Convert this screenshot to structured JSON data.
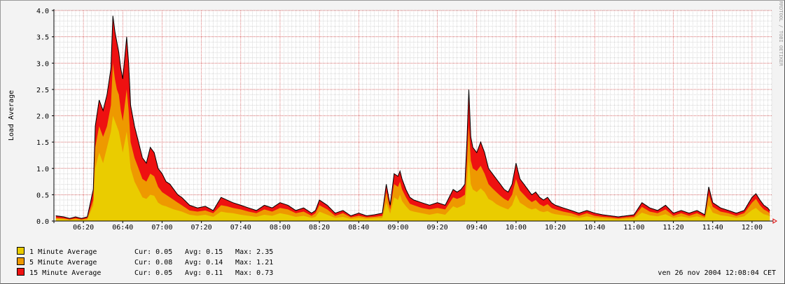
{
  "chart_data": {
    "type": "area",
    "ylabel": "Load Average",
    "ylim": [
      0,
      4.0
    ],
    "y_ticks": [
      "0.0",
      "0.5",
      "1.0",
      "1.5",
      "2.0",
      "2.5",
      "3.0",
      "3.5",
      "4.0"
    ],
    "x_ticks": [
      "06:20",
      "06:40",
      "07:00",
      "07:20",
      "07:40",
      "08:00",
      "08:20",
      "08:40",
      "09:00",
      "09:20",
      "09:40",
      "10:00",
      "10:20",
      "10:40",
      "11:00",
      "11:20",
      "11:40",
      "12:00"
    ],
    "x_start": "06:05",
    "x_end": "12:10",
    "grid": true,
    "watermark": "RRDTOOL / TOBI OETIKER",
    "series": [
      {
        "name": "15 Minute Average",
        "color": "#ee1111",
        "x": [
          "06:06",
          "06:10",
          "06:13",
          "06:16",
          "06:19",
          "06:22",
          "06:25",
          "06:26",
          "06:28",
          "06:30",
          "06:32",
          "06:34",
          "06:35",
          "06:36",
          "06:37",
          "06:38",
          "06:39",
          "06:40",
          "06:41",
          "06:42",
          "06:43",
          "06:44",
          "06:46",
          "06:48",
          "06:50",
          "06:52",
          "06:54",
          "06:56",
          "06:58",
          "07:00",
          "07:02",
          "07:04",
          "07:06",
          "07:08",
          "07:10",
          "07:14",
          "07:18",
          "07:22",
          "07:26",
          "07:30",
          "07:33",
          "07:36",
          "07:40",
          "07:44",
          "07:48",
          "07:52",
          "07:56",
          "08:00",
          "08:04",
          "08:08",
          "08:12",
          "08:16",
          "08:18",
          "08:20",
          "08:24",
          "08:28",
          "08:32",
          "08:36",
          "08:40",
          "08:44",
          "08:48",
          "08:52",
          "08:54",
          "08:56",
          "08:58",
          "09:00",
          "09:01",
          "09:02",
          "09:04",
          "09:06",
          "09:08",
          "09:12",
          "09:16",
          "09:20",
          "09:24",
          "09:28",
          "09:30",
          "09:32",
          "09:34",
          "09:35",
          "09:36",
          "09:37",
          "09:38",
          "09:40",
          "09:42",
          "09:44",
          "09:46",
          "09:48",
          "09:50",
          "09:52",
          "09:54",
          "09:56",
          "09:58",
          "10:00",
          "10:02",
          "10:04",
          "10:06",
          "10:08",
          "10:10",
          "10:12",
          "10:14",
          "10:16",
          "10:18",
          "10:20",
          "10:24",
          "10:28",
          "10:32",
          "10:36",
          "10:40",
          "10:44",
          "10:48",
          "10:52",
          "10:56",
          "11:00",
          "11:04",
          "11:08",
          "11:12",
          "11:16",
          "11:20",
          "11:24",
          "11:28",
          "11:32",
          "11:36",
          "11:38",
          "11:40",
          "11:44",
          "11:48",
          "11:52",
          "11:56",
          "12:00",
          "12:02",
          "12:04",
          "12:06",
          "12:08",
          "12:09"
        ],
        "values": [
          0.1,
          0.08,
          0.05,
          0.08,
          0.05,
          0.08,
          0.6,
          1.8,
          2.3,
          2.1,
          2.4,
          2.9,
          3.9,
          3.6,
          3.4,
          3.2,
          2.9,
          2.7,
          3.1,
          3.5,
          3.0,
          2.2,
          1.8,
          1.5,
          1.2,
          1.1,
          1.4,
          1.3,
          1.0,
          0.9,
          0.75,
          0.7,
          0.6,
          0.5,
          0.45,
          0.3,
          0.25,
          0.28,
          0.2,
          0.45,
          0.4,
          0.35,
          0.3,
          0.25,
          0.2,
          0.3,
          0.25,
          0.35,
          0.3,
          0.2,
          0.25,
          0.15,
          0.2,
          0.4,
          0.3,
          0.15,
          0.2,
          0.1,
          0.15,
          0.1,
          0.12,
          0.15,
          0.7,
          0.3,
          0.9,
          0.85,
          0.95,
          0.8,
          0.6,
          0.45,
          0.4,
          0.35,
          0.3,
          0.35,
          0.3,
          0.6,
          0.55,
          0.6,
          0.7,
          1.5,
          2.5,
          1.6,
          1.4,
          1.3,
          1.5,
          1.3,
          1.0,
          0.9,
          0.8,
          0.7,
          0.6,
          0.55,
          0.7,
          1.1,
          0.8,
          0.7,
          0.6,
          0.5,
          0.55,
          0.45,
          0.4,
          0.45,
          0.35,
          0.3,
          0.25,
          0.2,
          0.15,
          0.2,
          0.15,
          0.12,
          0.1,
          0.08,
          0.1,
          0.12,
          0.35,
          0.25,
          0.2,
          0.3,
          0.15,
          0.2,
          0.15,
          0.2,
          0.12,
          0.65,
          0.35,
          0.25,
          0.2,
          0.15,
          0.2,
          0.45,
          0.52,
          0.4,
          0.3,
          0.25,
          0.2
        ]
      },
      {
        "name": "5 Minute Average",
        "color": "#ee9900",
        "x": [
          "06:06",
          "06:10",
          "06:13",
          "06:16",
          "06:19",
          "06:22",
          "06:25",
          "06:26",
          "06:28",
          "06:30",
          "06:32",
          "06:34",
          "06:35",
          "06:36",
          "06:37",
          "06:38",
          "06:39",
          "06:40",
          "06:41",
          "06:42",
          "06:43",
          "06:44",
          "06:46",
          "06:48",
          "06:50",
          "06:52",
          "06:54",
          "06:56",
          "06:58",
          "07:00",
          "07:02",
          "07:04",
          "07:06",
          "07:08",
          "07:10",
          "07:14",
          "07:18",
          "07:22",
          "07:26",
          "07:30",
          "07:33",
          "07:36",
          "07:40",
          "07:44",
          "07:48",
          "07:52",
          "07:56",
          "08:00",
          "08:04",
          "08:08",
          "08:12",
          "08:16",
          "08:18",
          "08:20",
          "08:24",
          "08:28",
          "08:32",
          "08:36",
          "08:40",
          "08:44",
          "08:48",
          "08:52",
          "08:54",
          "08:56",
          "08:58",
          "09:00",
          "09:01",
          "09:02",
          "09:04",
          "09:06",
          "09:08",
          "09:12",
          "09:16",
          "09:20",
          "09:24",
          "09:28",
          "09:30",
          "09:32",
          "09:34",
          "09:35",
          "09:36",
          "09:37",
          "09:38",
          "09:40",
          "09:42",
          "09:44",
          "09:46",
          "09:48",
          "09:50",
          "09:52",
          "09:54",
          "09:56",
          "09:58",
          "10:00",
          "10:02",
          "10:04",
          "10:06",
          "10:08",
          "10:10",
          "10:12",
          "10:14",
          "10:16",
          "10:18",
          "10:20",
          "10:24",
          "10:28",
          "10:32",
          "10:36",
          "10:40",
          "10:44",
          "10:48",
          "10:52",
          "10:56",
          "11:00",
          "11:04",
          "11:08",
          "11:12",
          "11:16",
          "11:20",
          "11:24",
          "11:28",
          "11:32",
          "11:36",
          "11:38",
          "11:40",
          "11:44",
          "11:48",
          "11:52",
          "11:56",
          "12:00",
          "12:02",
          "12:04",
          "12:06",
          "12:08",
          "12:09"
        ],
        "values": [
          0.06,
          0.05,
          0.03,
          0.05,
          0.03,
          0.05,
          0.4,
          1.4,
          1.8,
          1.6,
          1.8,
          2.2,
          3.0,
          2.7,
          2.5,
          2.4,
          2.1,
          1.9,
          2.2,
          2.5,
          2.1,
          1.5,
          1.2,
          1.0,
          0.8,
          0.75,
          0.9,
          0.85,
          0.65,
          0.55,
          0.5,
          0.45,
          0.4,
          0.35,
          0.3,
          0.2,
          0.18,
          0.2,
          0.15,
          0.3,
          0.28,
          0.25,
          0.22,
          0.18,
          0.15,
          0.22,
          0.18,
          0.25,
          0.22,
          0.15,
          0.18,
          0.1,
          0.15,
          0.3,
          0.22,
          0.1,
          0.15,
          0.07,
          0.1,
          0.07,
          0.08,
          0.1,
          0.55,
          0.22,
          0.7,
          0.65,
          0.75,
          0.6,
          0.45,
          0.33,
          0.3,
          0.25,
          0.22,
          0.25,
          0.22,
          0.45,
          0.42,
          0.45,
          0.5,
          1.1,
          1.8,
          1.15,
          1.0,
          0.95,
          1.05,
          0.9,
          0.7,
          0.62,
          0.55,
          0.48,
          0.42,
          0.38,
          0.5,
          0.8,
          0.58,
          0.5,
          0.42,
          0.36,
          0.4,
          0.32,
          0.28,
          0.32,
          0.25,
          0.22,
          0.18,
          0.15,
          0.1,
          0.15,
          0.1,
          0.08,
          0.07,
          0.05,
          0.07,
          0.08,
          0.27,
          0.18,
          0.15,
          0.22,
          0.1,
          0.15,
          0.1,
          0.15,
          0.08,
          0.5,
          0.27,
          0.18,
          0.15,
          0.1,
          0.15,
          0.35,
          0.42,
          0.3,
          0.22,
          0.18,
          0.15
        ]
      },
      {
        "name": "1 Minute Average",
        "color": "#eacc00",
        "x": [
          "06:06",
          "06:10",
          "06:13",
          "06:16",
          "06:19",
          "06:22",
          "06:25",
          "06:26",
          "06:28",
          "06:30",
          "06:32",
          "06:34",
          "06:35",
          "06:36",
          "06:37",
          "06:38",
          "06:39",
          "06:40",
          "06:41",
          "06:42",
          "06:43",
          "06:44",
          "06:46",
          "06:48",
          "06:50",
          "06:52",
          "06:54",
          "06:56",
          "06:58",
          "07:00",
          "07:02",
          "07:04",
          "07:06",
          "07:08",
          "07:10",
          "07:14",
          "07:18",
          "07:22",
          "07:26",
          "07:30",
          "07:33",
          "07:36",
          "07:40",
          "07:44",
          "07:48",
          "07:52",
          "07:56",
          "08:00",
          "08:04",
          "08:08",
          "08:12",
          "08:16",
          "08:18",
          "08:20",
          "08:24",
          "08:28",
          "08:32",
          "08:36",
          "08:40",
          "08:44",
          "08:48",
          "08:52",
          "08:54",
          "08:56",
          "08:58",
          "09:00",
          "09:01",
          "09:02",
          "09:04",
          "09:06",
          "09:08",
          "09:12",
          "09:16",
          "09:20",
          "09:24",
          "09:28",
          "09:30",
          "09:32",
          "09:34",
          "09:35",
          "09:36",
          "09:37",
          "09:38",
          "09:40",
          "09:42",
          "09:44",
          "09:46",
          "09:48",
          "09:50",
          "09:52",
          "09:54",
          "09:56",
          "09:58",
          "10:00",
          "10:02",
          "10:04",
          "10:06",
          "10:08",
          "10:10",
          "10:12",
          "10:14",
          "10:16",
          "10:18",
          "10:20",
          "10:24",
          "10:28",
          "10:32",
          "10:36",
          "10:40",
          "10:44",
          "10:48",
          "10:52",
          "10:56",
          "11:00",
          "11:04",
          "11:08",
          "11:12",
          "11:16",
          "11:20",
          "11:24",
          "11:28",
          "11:32",
          "11:36",
          "11:38",
          "11:40",
          "11:44",
          "11:48",
          "11:52",
          "11:56",
          "12:00",
          "12:02",
          "12:04",
          "12:06",
          "12:08",
          "12:09"
        ],
        "values": [
          0.04,
          0.03,
          0.02,
          0.03,
          0.02,
          0.03,
          0.3,
          1.0,
          1.3,
          1.1,
          1.4,
          1.7,
          2.0,
          1.9,
          1.8,
          1.7,
          1.5,
          1.3,
          1.5,
          1.7,
          1.4,
          1.0,
          0.75,
          0.6,
          0.45,
          0.42,
          0.5,
          0.48,
          0.35,
          0.3,
          0.28,
          0.25,
          0.22,
          0.2,
          0.18,
          0.12,
          0.1,
          0.12,
          0.08,
          0.18,
          0.16,
          0.15,
          0.12,
          0.1,
          0.08,
          0.12,
          0.1,
          0.15,
          0.12,
          0.08,
          0.1,
          0.06,
          0.08,
          0.18,
          0.12,
          0.06,
          0.08,
          0.04,
          0.06,
          0.04,
          0.05,
          0.06,
          0.35,
          0.14,
          0.45,
          0.4,
          0.5,
          0.38,
          0.28,
          0.2,
          0.18,
          0.15,
          0.12,
          0.15,
          0.12,
          0.28,
          0.25,
          0.28,
          0.32,
          0.7,
          1.2,
          0.7,
          0.6,
          0.55,
          0.62,
          0.55,
          0.42,
          0.38,
          0.32,
          0.28,
          0.25,
          0.22,
          0.3,
          0.5,
          0.35,
          0.3,
          0.25,
          0.22,
          0.24,
          0.19,
          0.17,
          0.19,
          0.15,
          0.13,
          0.11,
          0.09,
          0.06,
          0.09,
          0.06,
          0.05,
          0.04,
          0.03,
          0.04,
          0.05,
          0.16,
          0.11,
          0.09,
          0.13,
          0.06,
          0.09,
          0.06,
          0.09,
          0.05,
          0.3,
          0.16,
          0.11,
          0.09,
          0.06,
          0.09,
          0.21,
          0.25,
          0.18,
          0.13,
          0.11,
          0.09
        ]
      }
    ]
  },
  "legend": [
    {
      "swatch": "#eacc00",
      "label": "1 Minute Average",
      "cur": "Cur: 0.05",
      "avg": "Avg: 0.15",
      "max": "Max: 2.35"
    },
    {
      "swatch": "#ee9900",
      "label": "5 Minute Average",
      "cur": "Cur: 0.08",
      "avg": "Avg: 0.14",
      "max": "Max: 1.21"
    },
    {
      "swatch": "#ee1111",
      "label": "15 Minute Average",
      "cur": "Cur: 0.05",
      "avg": "Avg: 0.11",
      "max": "Max: 0.73"
    }
  ],
  "timestamp": "ven 26 nov 2004 12:08:04 CET"
}
